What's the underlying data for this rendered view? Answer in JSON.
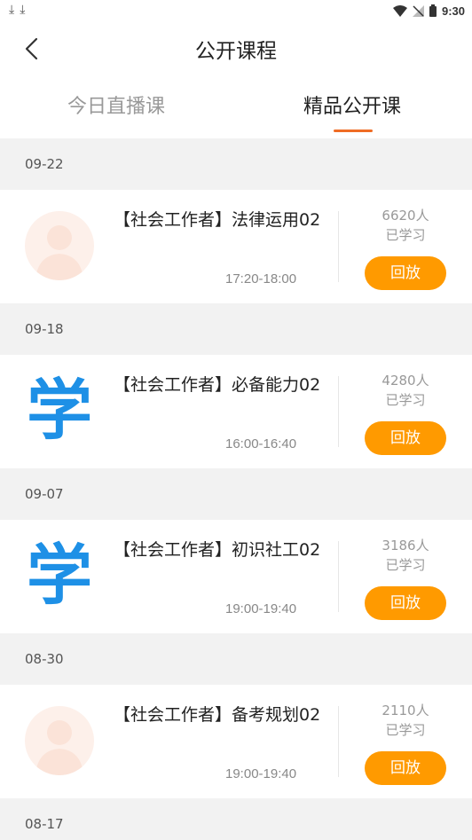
{
  "status_bar": {
    "time": "9:30",
    "left_icons": [
      "download-icon",
      "download-icon"
    ]
  },
  "header": {
    "title": "公开课程"
  },
  "tabs": [
    {
      "label": "今日直播课",
      "active": false
    },
    {
      "label": "精品公开课",
      "active": true
    }
  ],
  "colors": {
    "accent": "#ef6c24",
    "replay_button": "#ff9a00",
    "xue_icon": "#1e90e6"
  },
  "sessions": [
    {
      "date": "09-22",
      "thumbnail": "avatar-placeholder",
      "title": "【社会工作者】法律运用02",
      "time": "17:20-18:00",
      "learners": "6620人",
      "learned_label": "已学习",
      "button": "回放"
    },
    {
      "date": "09-18",
      "thumbnail": "xue-logo",
      "thumbnail_text": "学",
      "title": "【社会工作者】必备能力02",
      "time": "16:00-16:40",
      "learners": "4280人",
      "learned_label": "已学习",
      "button": "回放"
    },
    {
      "date": "09-07",
      "thumbnail": "xue-logo",
      "thumbnail_text": "学",
      "title": "【社会工作者】初识社工02",
      "time": "19:00-19:40",
      "learners": "3186人",
      "learned_label": "已学习",
      "button": "回放"
    },
    {
      "date": "08-30",
      "thumbnail": "avatar-placeholder",
      "title": "【社会工作者】备考规划02",
      "time": "19:00-19:40",
      "learners": "2110人",
      "learned_label": "已学习",
      "button": "回放"
    }
  ],
  "next_date": "08-17"
}
